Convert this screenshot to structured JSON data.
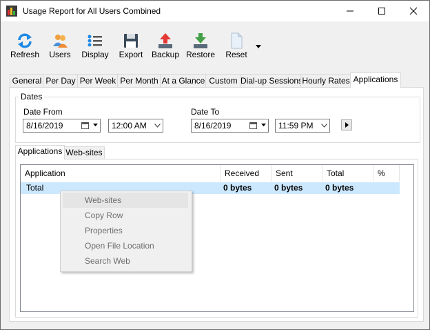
{
  "window": {
    "title": "Usage Report for All Users Combined"
  },
  "toolbar": {
    "items": [
      {
        "label": "Refresh",
        "icon": "refresh-icon"
      },
      {
        "label": "Users",
        "icon": "users-icon"
      },
      {
        "label": "Display",
        "icon": "display-icon"
      },
      {
        "label": "Export",
        "icon": "save-icon"
      },
      {
        "label": "Backup",
        "icon": "backup-icon"
      },
      {
        "label": "Restore",
        "icon": "restore-icon"
      },
      {
        "label": "Reset",
        "icon": "document-icon"
      }
    ]
  },
  "tabs": [
    "General",
    "Per Day",
    "Per Week",
    "Per Month",
    "At a Glance",
    "Custom",
    "Dial-up Sessions",
    "Hourly Rates",
    "Applications"
  ],
  "active_tab": "Applications",
  "dates": {
    "group_label": "Dates",
    "from_label": "Date From",
    "from_date": "8/16/2019",
    "from_time": "12:00 AM",
    "to_label": "Date To",
    "to_date": "8/16/2019",
    "to_time": "11:59 PM"
  },
  "subtabs": [
    "Applications",
    "Web-sites"
  ],
  "table": {
    "columns": [
      "Application",
      "Received",
      "Sent",
      "Total",
      "%"
    ],
    "rows": [
      {
        "application": "Total",
        "received": "0 bytes",
        "sent": "0 bytes",
        "total": "0 bytes",
        "percent": ""
      }
    ]
  },
  "context_menu": {
    "items": [
      "Web-sites",
      "Copy Row",
      "Properties",
      "Open File Location",
      "Search Web"
    ],
    "highlighted": "Web-sites"
  },
  "colors": {
    "selection": "#cce8ff",
    "accent": "#1e90ff"
  }
}
